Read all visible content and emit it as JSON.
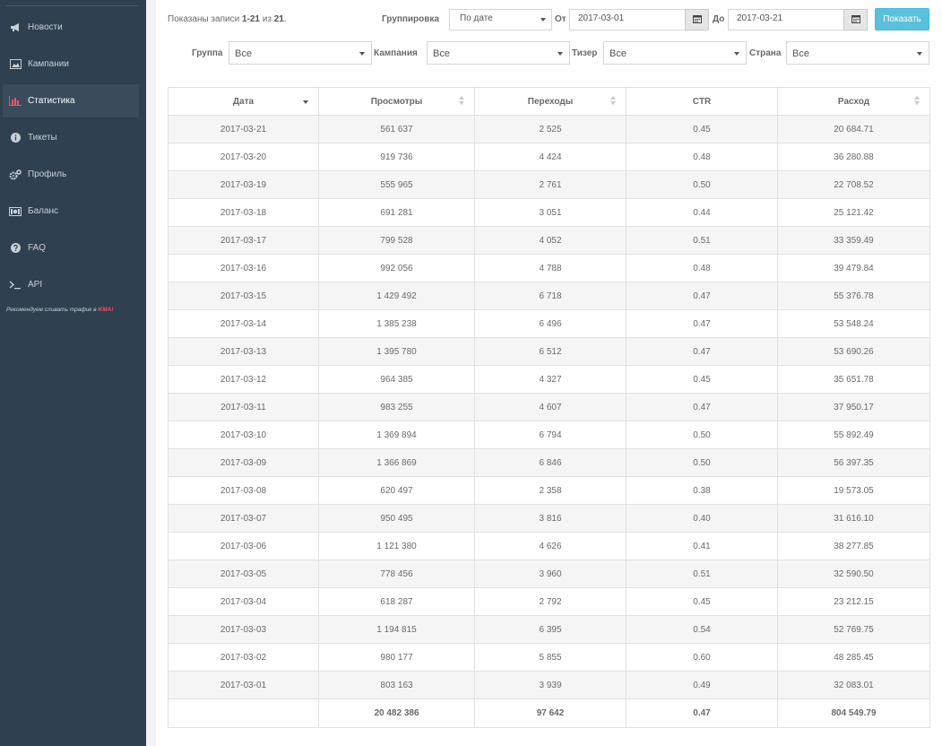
{
  "sidebar": {
    "items": [
      {
        "label": "Новости",
        "icon": "megaphone-icon",
        "active": false
      },
      {
        "label": "Кампании",
        "icon": "image-icon",
        "active": false
      },
      {
        "label": "Статистика",
        "icon": "bar-chart-icon",
        "active": true
      },
      {
        "label": "Тикеты",
        "icon": "info-circle-icon",
        "active": false
      },
      {
        "label": "Профиль",
        "icon": "gears-icon",
        "active": false
      },
      {
        "label": "Баланс",
        "icon": "money-icon",
        "active": false
      },
      {
        "label": "FAQ",
        "icon": "question-circle-icon",
        "active": false
      },
      {
        "label": "API",
        "icon": "terminal-icon",
        "active": false
      }
    ],
    "promo_text": "Рекомендуем сливать трафик в ",
    "promo_brand": "KMA!"
  },
  "summary": {
    "prefix": "Показаны записи ",
    "range": "1-21",
    "middle": " из ",
    "total": "21",
    "suffix": "."
  },
  "filters": {
    "grouping_label": "Группировка",
    "grouping_value": "По дате",
    "from_label": "От",
    "from_value": "2017-03-01",
    "to_label": "До",
    "to_value": "2017-03-21",
    "show_button": "Показать",
    "group_label": "Группа",
    "group_value": "Все",
    "campaign_label": "Кампания",
    "campaign_value": "Все",
    "teaser_label": "Тизер",
    "teaser_value": "Все",
    "country_label": "Страна",
    "country_value": "Все"
  },
  "table": {
    "headers": [
      "Дата",
      "Просмотры",
      "Переходы",
      "CTR",
      "Расход"
    ],
    "rows": [
      [
        "2017-03-21",
        "561 637",
        "2 525",
        "0.45",
        "20 684.71"
      ],
      [
        "2017-03-20",
        "919 736",
        "4 424",
        "0.48",
        "36 280.88"
      ],
      [
        "2017-03-19",
        "555 965",
        "2 761",
        "0.50",
        "22 708.52"
      ],
      [
        "2017-03-18",
        "691 281",
        "3 051",
        "0.44",
        "25 121.42"
      ],
      [
        "2017-03-17",
        "799 528",
        "4 052",
        "0.51",
        "33 359.49"
      ],
      [
        "2017-03-16",
        "992 056",
        "4 788",
        "0.48",
        "39 479.84"
      ],
      [
        "2017-03-15",
        "1 429 492",
        "6 718",
        "0.47",
        "55 376.78"
      ],
      [
        "2017-03-14",
        "1 385 238",
        "6 496",
        "0.47",
        "53 548.24"
      ],
      [
        "2017-03-13",
        "1 395 780",
        "6 512",
        "0.47",
        "53 690.26"
      ],
      [
        "2017-03-12",
        "964 385",
        "4 327",
        "0.45",
        "35 651.78"
      ],
      [
        "2017-03-11",
        "983 255",
        "4 607",
        "0.47",
        "37 950.17"
      ],
      [
        "2017-03-10",
        "1 369 894",
        "6 794",
        "0.50",
        "55 892.49"
      ],
      [
        "2017-03-09",
        "1 366 869",
        "6 846",
        "0.50",
        "56 397.35"
      ],
      [
        "2017-03-08",
        "620 497",
        "2 358",
        "0.38",
        "19 573.05"
      ],
      [
        "2017-03-07",
        "950 495",
        "3 816",
        "0.40",
        "31 616.10"
      ],
      [
        "2017-03-06",
        "1 121 380",
        "4 626",
        "0.41",
        "38 277.85"
      ],
      [
        "2017-03-05",
        "778 456",
        "3 960",
        "0.51",
        "32 590.50"
      ],
      [
        "2017-03-04",
        "618 287",
        "2 792",
        "0.45",
        "23 212.15"
      ],
      [
        "2017-03-03",
        "1 194 815",
        "6 395",
        "0.54",
        "52 769.75"
      ],
      [
        "2017-03-02",
        "980 177",
        "5 855",
        "0.60",
        "48 285.45"
      ],
      [
        "2017-03-01",
        "803 163",
        "3 939",
        "0.49",
        "32 083.01"
      ]
    ],
    "totals": [
      "",
      "20 482 386",
      "97 642",
      "0.47",
      "804 549.79"
    ]
  },
  "colors": {
    "sidebar_bg": "#2f4050",
    "accent_info": "#5bc0de",
    "brand_red": "#ed5565"
  }
}
